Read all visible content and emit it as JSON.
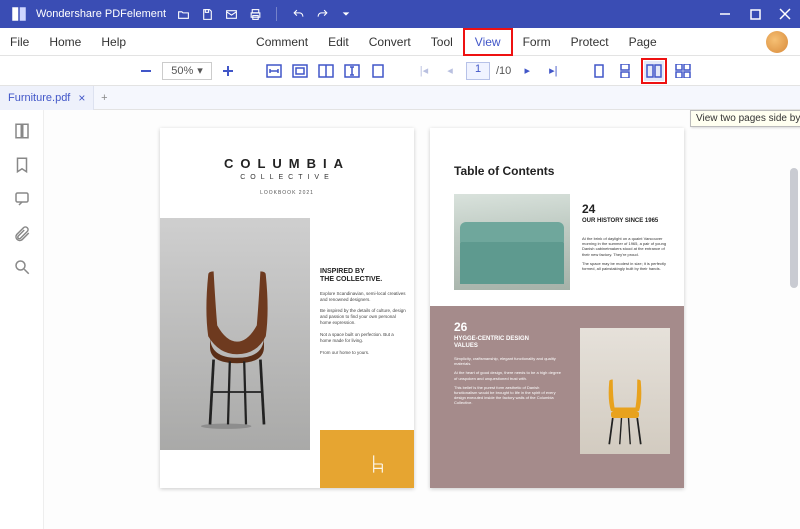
{
  "app": {
    "title": "Wondershare PDFelement"
  },
  "menu": {
    "file": "File",
    "home": "Home",
    "help": "Help",
    "comment": "Comment",
    "edit": "Edit",
    "convert": "Convert",
    "tool": "Tool",
    "view": "View",
    "form": "Form",
    "protect": "Protect",
    "page": "Page"
  },
  "toolbar": {
    "zoom": "50%",
    "page_current": "1",
    "page_total": "/10"
  },
  "tab": {
    "filename": "Furniture.pdf"
  },
  "tooltip": {
    "two_page": "View two pages side by side"
  },
  "doc": {
    "p1": {
      "brand": "COLUMBIA",
      "sub": "COLLECTIVE",
      "year": "LOOKBOOK 2021",
      "head1": "INSPIRED BY",
      "head2": "THE COLLECTIVE.",
      "para1": "Explore Scandinavian, semi-local creatives and renowned designers.",
      "para2": "Be inspired by the details of culture, design and passion to find your own personal home expression.",
      "para3": "Not a space built on perfection. But a home made for living.",
      "para4": "From our home to yours."
    },
    "p2": {
      "toc": "Table of Contents",
      "n1": "24",
      "h1": "OUR HISTORY SINCE 1965",
      "b1a": "At the brink of daylight on a quaint Vancouver morning in the summer of 1965, a pair of young Danish cabinetmakers stood at the entrance of their new factory. They're proud.",
      "b1b": "The space may be modest in size; it is perfectly formed, all painstakingly built by their hands.",
      "n2": "26",
      "h2": "HYGGE-CENTRIC DESIGN VALUES",
      "b2a": "Simplicity, craftsmanship, elegant functionality and quality materials.",
      "b2b": "At the heart of good design, there needs to be a high degree of unspoken and unquestioned trust with.",
      "b2c": "This belief is the purest form aesthetic of Danish functionalism would be brought to life in the spirit of every design executed inside the factory walls of the Columbia Collective."
    }
  }
}
